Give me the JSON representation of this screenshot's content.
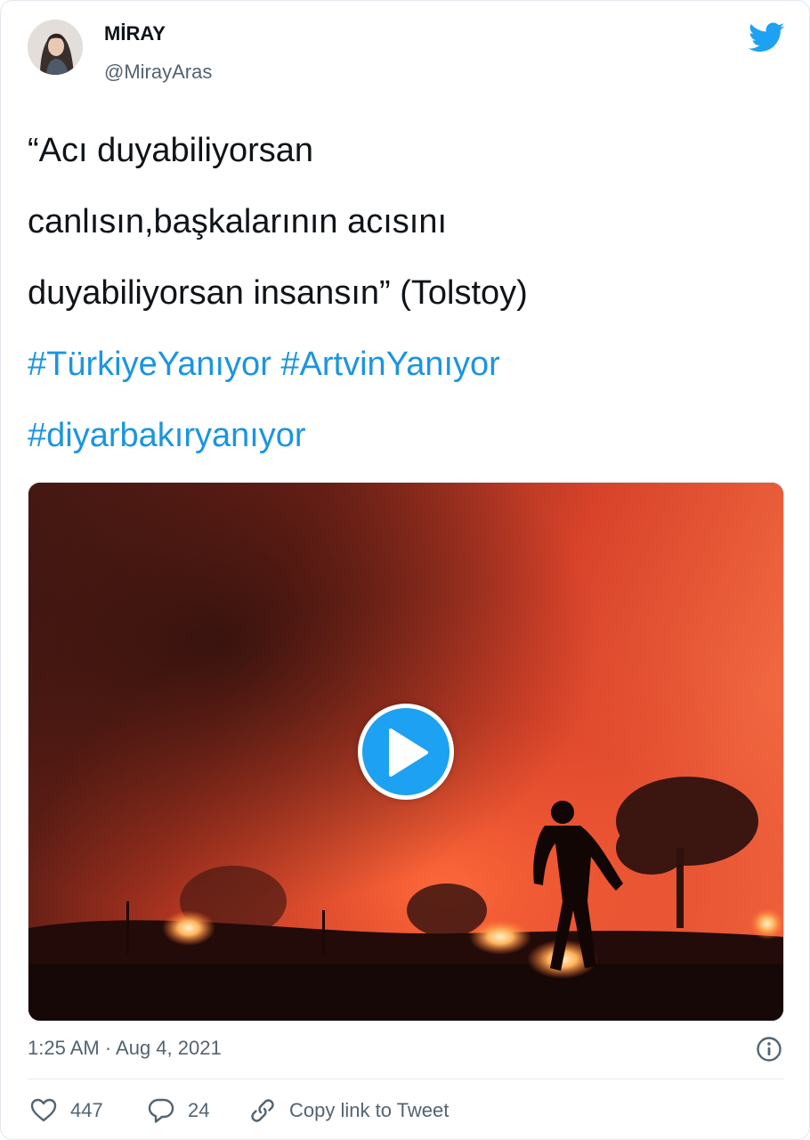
{
  "user": {
    "display_name": "MİRAY",
    "handle": "@MirayAras",
    "avatar_icon": "profile-photo"
  },
  "brand": {
    "icon": "twitter-bird-icon",
    "color": "#1da1f2"
  },
  "tweet": {
    "lines": [
      "“Acı duyabiliyorsan",
      "canlısın,başkalarının acısını",
      "duyabiliyorsan insansın” (Tolstoy)"
    ],
    "hashtags_line1": [
      "#TürkiyeYanıyor",
      "#ArtvinYanıyor"
    ],
    "hashtags_line2": [
      "#diyarbakıryanıyor"
    ],
    "hashtag_color": "#1b95e0"
  },
  "media": {
    "type": "video",
    "play_icon": "play-icon"
  },
  "meta": {
    "timestamp": "1:25 AM · Aug 4, 2021",
    "info_icon": "info-icon"
  },
  "actions": {
    "likes": "447",
    "replies": "24",
    "copy_link": "Copy link to Tweet"
  }
}
